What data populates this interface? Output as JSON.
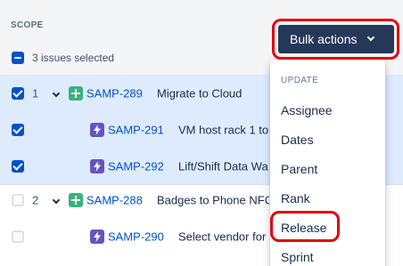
{
  "scope": {
    "title": "SCOPE",
    "selection_text": "3 issues selected"
  },
  "rows": [
    {
      "num": "1",
      "key": "SAMP-289",
      "summary": "Migrate to Cloud",
      "type": "epic",
      "checked": true
    },
    {
      "num": "",
      "key": "SAMP-291",
      "summary": "VM host rack 1 to",
      "type": "subtask",
      "checked": true
    },
    {
      "num": "",
      "key": "SAMP-292",
      "summary": "Lift/Shift Data Wa",
      "type": "subtask",
      "checked": true
    },
    {
      "num": "2",
      "key": "SAMP-288",
      "summary": "Badges to Phone NFC",
      "type": "epic",
      "checked": false
    },
    {
      "num": "",
      "key": "SAMP-290",
      "summary": "Select vendor for",
      "type": "subtask",
      "checked": false
    }
  ],
  "bulk_actions": {
    "label": "Bulk actions",
    "menu": {
      "heading": "UPDATE",
      "items": [
        "Assignee",
        "Dates",
        "Parent",
        "Rank",
        "Release",
        "Sprint"
      ]
    }
  },
  "colors": {
    "primary": "#0052cc",
    "selected_row_bg": "#deebff",
    "button_bg": "#253858",
    "annotation": "#e3000f",
    "epic_icon": "#36b37e",
    "subtask_icon": "#6554c0"
  },
  "icons": {
    "epic": "plus-square-icon",
    "subtask": "lightning-bolt-icon",
    "expand": "chevron-down-icon"
  }
}
